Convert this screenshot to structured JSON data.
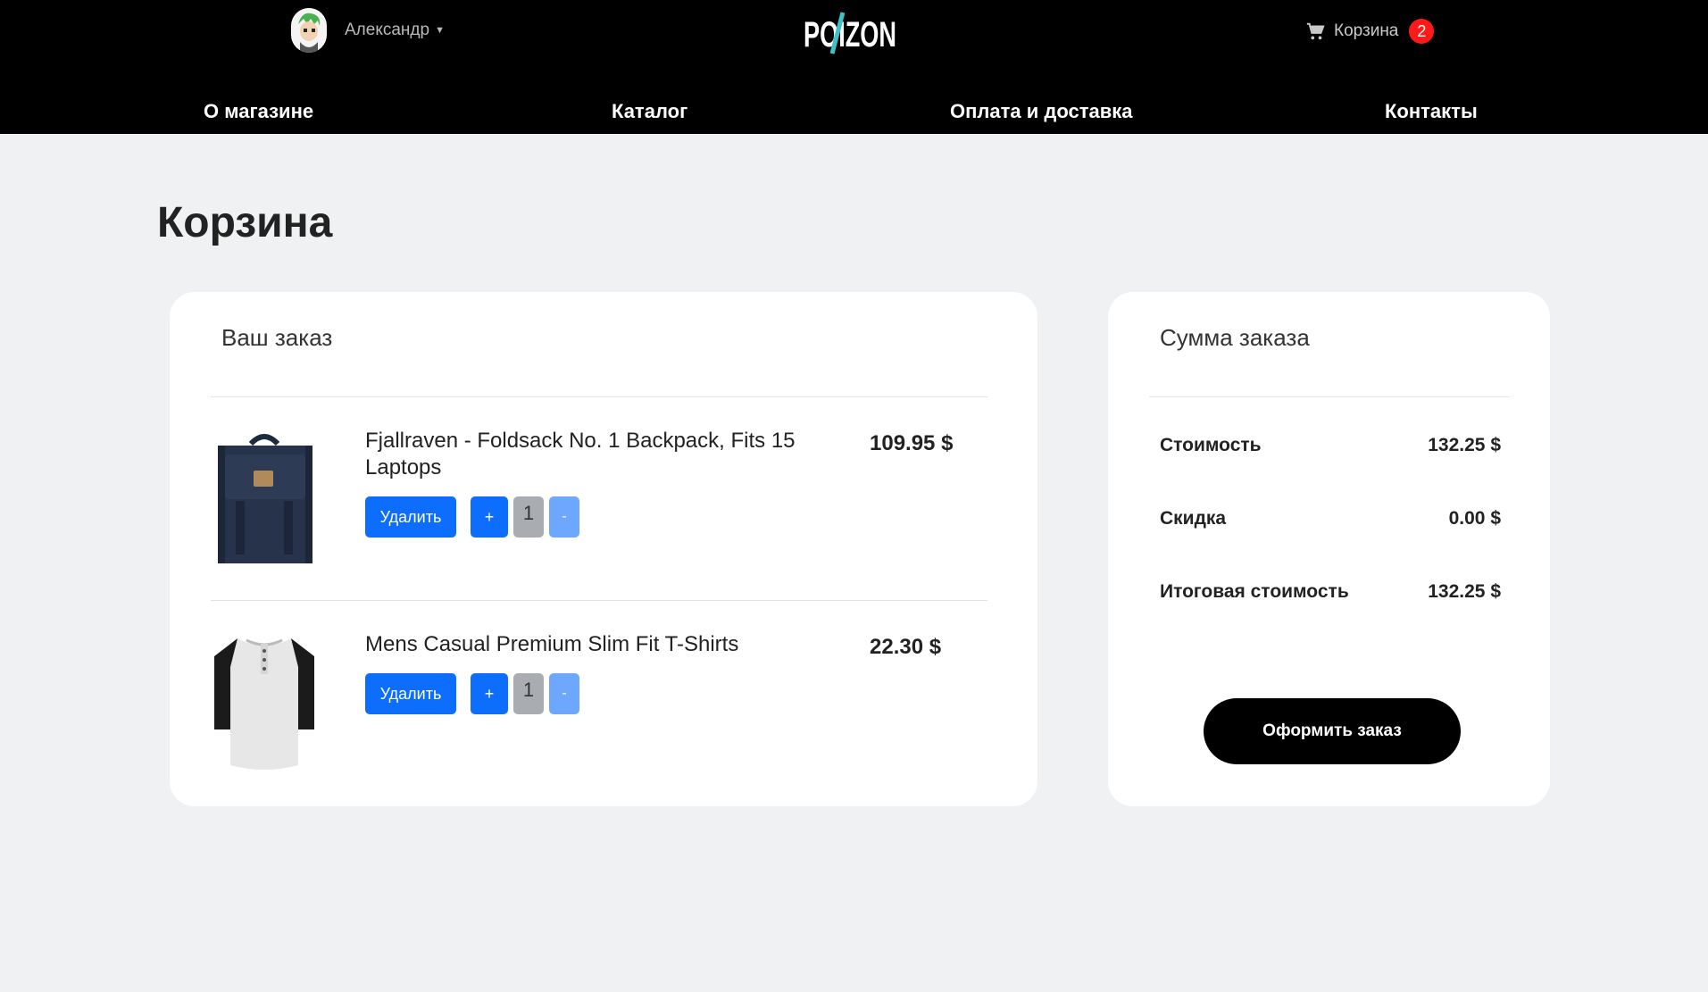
{
  "header": {
    "user_name": "Александр",
    "logo_text": "POIZON",
    "cart_label": "Корзина",
    "cart_count": "2"
  },
  "nav": {
    "items": [
      {
        "label": "О магазине"
      },
      {
        "label": "Каталог"
      },
      {
        "label": "Оплата и доставка"
      },
      {
        "label": "Контакты"
      }
    ]
  },
  "page_title": "Корзина",
  "order": {
    "title": "Ваш заказ",
    "items": [
      {
        "name": "Fjallraven - Foldsack No. 1 Backpack, Fits 15 Laptops",
        "price": "109.95 $",
        "delete_label": "Удалить",
        "plus_label": "+",
        "quantity": "1",
        "minus_label": "-"
      },
      {
        "name": "Mens Casual Premium Slim Fit T-Shirts",
        "price": "22.30 $",
        "delete_label": "Удалить",
        "plus_label": "+",
        "quantity": "1",
        "minus_label": "-"
      }
    ]
  },
  "summary": {
    "title": "Сумма заказа",
    "rows": [
      {
        "label": "Стоимость",
        "value": "132.25 $"
      },
      {
        "label": "Скидка",
        "value": "0.00 $"
      },
      {
        "label": "Итоговая стоимость",
        "value": "132.25 $"
      }
    ],
    "checkout_label": "Оформить заказ"
  },
  "colors": {
    "header_bg": "#000000",
    "page_bg": "#f0f1f3",
    "primary_button": "#0d6efd",
    "badge": "#ff1a1a",
    "logo_accent": "#3fc1c9"
  }
}
